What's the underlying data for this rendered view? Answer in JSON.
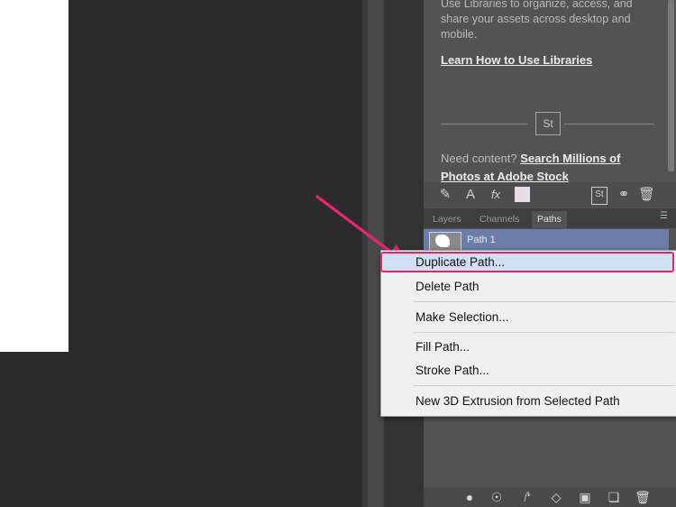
{
  "library": {
    "intro_text": "Use Libraries to organize, access, and share your assets across desktop and mobile.",
    "learn_link": "Learn How to Use Libraries",
    "stock_badge": "St",
    "need_content": "Need content?",
    "search_link": "Search Millions of Photos at Adobe Stock"
  },
  "library_toolbar": {
    "icon_text": "St"
  },
  "tabs": [
    {
      "label": "Layers"
    },
    {
      "label": "Channels"
    },
    {
      "label": "Paths"
    }
  ],
  "active_tab": "Paths",
  "paths": [
    {
      "name": "Path 1"
    }
  ],
  "context_menu": {
    "items": [
      {
        "label": "Duplicate Path...",
        "highlighted": true
      },
      {
        "label": "Delete Path"
      },
      {
        "label": "Make Selection..."
      },
      {
        "label": "Fill Path..."
      },
      {
        "label": "Stroke Path..."
      },
      {
        "label": "New 3D Extrusion from Selected Path"
      }
    ]
  },
  "colors": {
    "annotation_arrow": "#e0276d",
    "highlight_fill": "#cfe0f3",
    "panel_bg": "#535353",
    "selected_row": "#6c7ea8"
  }
}
